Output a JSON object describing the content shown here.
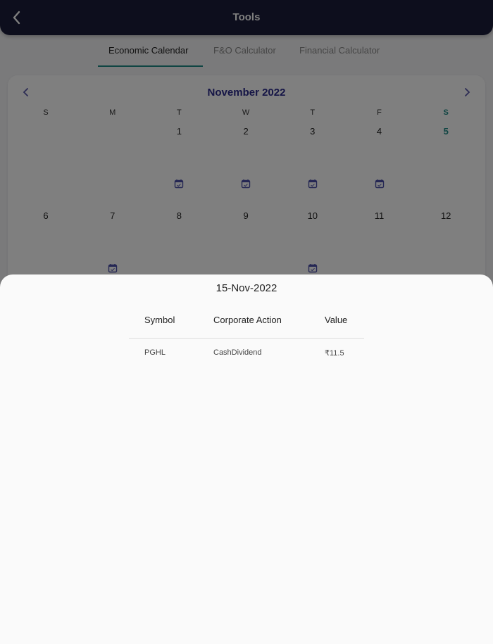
{
  "header": {
    "title": "Tools",
    "back_icon": "chevron-left-icon"
  },
  "tabs": [
    {
      "label": "Economic Calendar",
      "active": true
    },
    {
      "label": "F&O Calculator",
      "active": false
    },
    {
      "label": "Financial Calculator",
      "active": false
    }
  ],
  "calendar": {
    "month_label": "November 2022",
    "prev_icon": "chevron-left-icon",
    "next_icon": "chevron-right-icon",
    "weekdays": [
      "S",
      "M",
      "T",
      "W",
      "T",
      "F",
      "S"
    ],
    "weeks": [
      [
        {
          "day": ""
        },
        {
          "day": ""
        },
        {
          "day": "1",
          "event": true
        },
        {
          "day": "2",
          "event": true
        },
        {
          "day": "3",
          "event": true
        },
        {
          "day": "4",
          "event": true
        },
        {
          "day": "5"
        }
      ],
      [
        {
          "day": "6"
        },
        {
          "day": "7",
          "event": true
        },
        {
          "day": "8"
        },
        {
          "day": "9"
        },
        {
          "day": "10",
          "event": true
        },
        {
          "day": "11"
        },
        {
          "day": "12"
        }
      ]
    ],
    "event_icon": "calendar-check-icon",
    "accent": "#1f8a86",
    "month_color": "#2b2a8c"
  },
  "sheet": {
    "date": "15-Nov-2022",
    "columns": [
      "Symbol",
      "Corporate Action",
      "Value"
    ],
    "rows": [
      {
        "symbol": "PGHL",
        "action": "CashDividend",
        "value": "₹11.5"
      }
    ]
  }
}
